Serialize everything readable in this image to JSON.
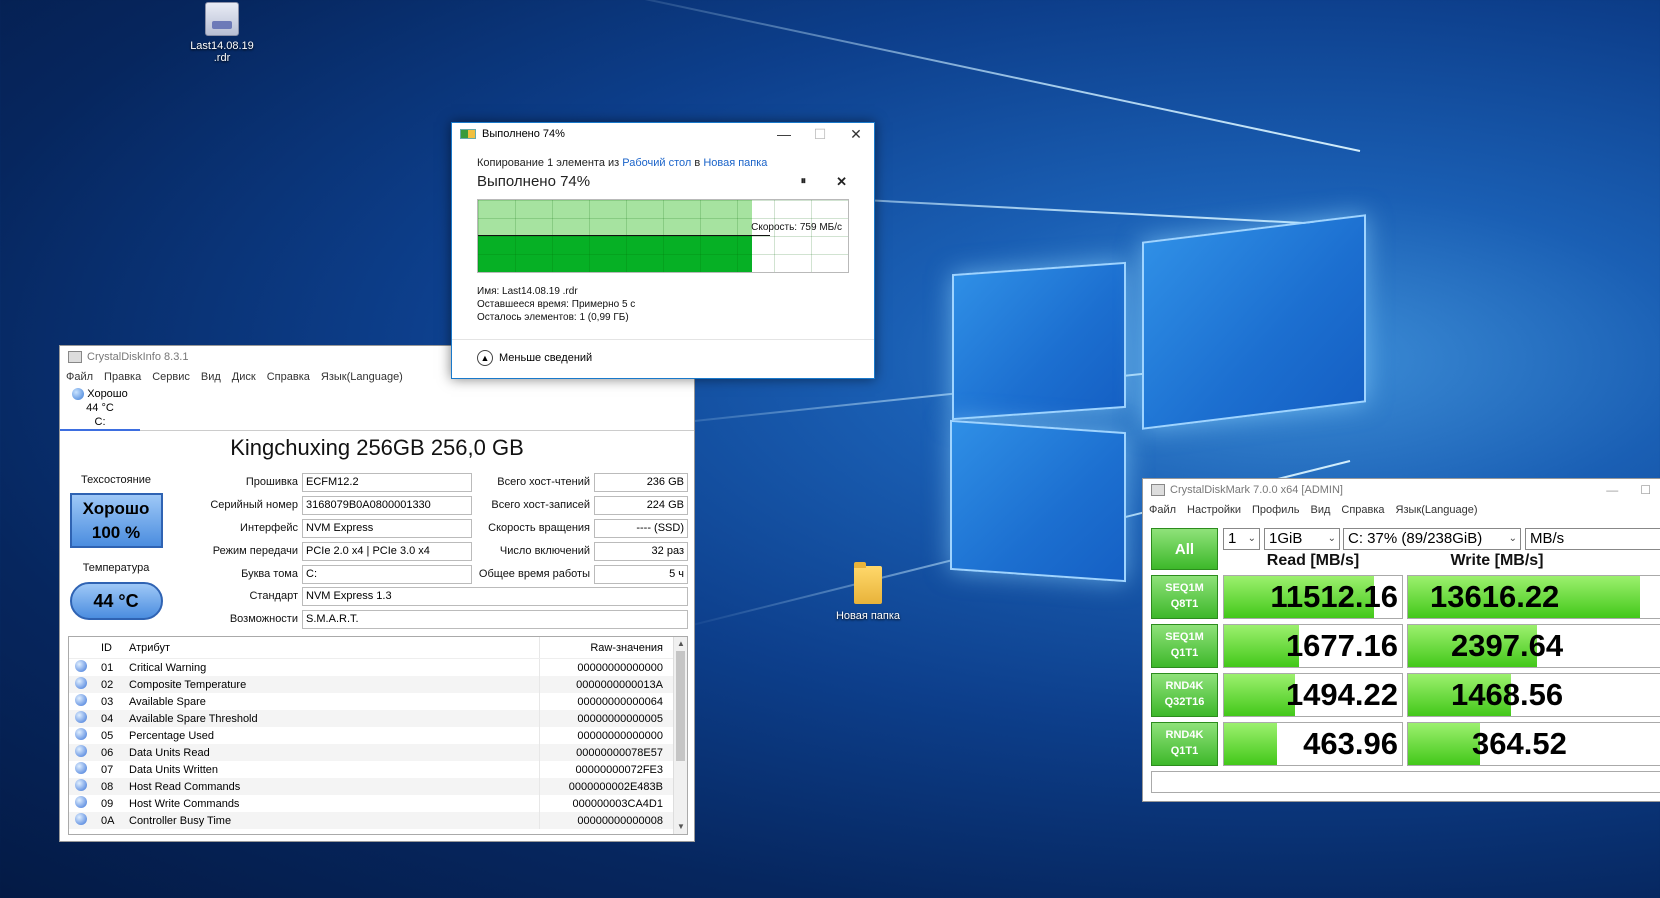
{
  "desktop": {
    "icons": [
      {
        "label1": "Last14.08.19",
        "label2": ".rdr"
      },
      {
        "label1": "Новая папка",
        "label2": ""
      }
    ]
  },
  "copy_dialog": {
    "title": "Выполнено 74%",
    "line_prefix": "Копирование 1 элемента из",
    "from": "Рабочий стол",
    "in_word": "в",
    "to": "Новая папка",
    "heading": "Выполнено 74%",
    "pause_glyph": "⏸",
    "close_glyph": "✕",
    "progress": 0.74,
    "speed": "Скорость: 759 МБ/с",
    "name_label": "Имя:",
    "name_value": "Last14.08.19 .rdr",
    "time_label": "Оставшееся время:",
    "time_value": "Примерно 5 с",
    "items_label": "Осталось элементов:",
    "items_value": "1 (0,99 ГБ)",
    "less_details": "Меньше сведений"
  },
  "cdi": {
    "title": "CrystalDiskInfo 8.3.1",
    "menu": [
      "Файл",
      "Правка",
      "Сервис",
      "Вид",
      "Диск",
      "Справка",
      "Язык(Language)"
    ],
    "tab_status": "Хорошо",
    "tab_temp": "44 °C",
    "tab_drive": "C:",
    "model": "Kingchuxing 256GB 256,0 GB",
    "health_label": "Техсостояние",
    "health_status": "Хорошо",
    "health_percent": "100 %",
    "temp_label": "Температура",
    "temp_value": "44 °C",
    "fields_left": [
      {
        "k": "Прошивка",
        "v": "ECFM12.2"
      },
      {
        "k": "Серийный номер",
        "v": "3168079B0A0800001330"
      },
      {
        "k": "Интерфейс",
        "v": "NVM Express"
      },
      {
        "k": "Режим передачи",
        "v": "PCIe 2.0 x4 | PCIe 3.0 x4"
      },
      {
        "k": "Буква тома",
        "v": "C:"
      },
      {
        "k": "Стандарт",
        "v": "NVM Express 1.3"
      },
      {
        "k": "Возможности",
        "v": "S.M.A.R.T."
      }
    ],
    "fields_right": [
      {
        "k": "Всего хост-чтений",
        "v": "236 GB"
      },
      {
        "k": "Всего хост-записей",
        "v": "224 GB"
      },
      {
        "k": "Скорость вращения",
        "v": "---- (SSD)"
      },
      {
        "k": "Число включений",
        "v": "32 раз"
      },
      {
        "k": "Общее время работы",
        "v": "5 ч"
      }
    ],
    "table_headers": {
      "id": "ID",
      "attr": "Атрибут",
      "raw": "Raw-значения"
    },
    "rows": [
      {
        "id": "01",
        "name": "Critical Warning",
        "raw": "00000000000000"
      },
      {
        "id": "02",
        "name": "Composite Temperature",
        "raw": "0000000000013A"
      },
      {
        "id": "03",
        "name": "Available Spare",
        "raw": "00000000000064"
      },
      {
        "id": "04",
        "name": "Available Spare Threshold",
        "raw": "00000000000005"
      },
      {
        "id": "05",
        "name": "Percentage Used",
        "raw": "00000000000000"
      },
      {
        "id": "06",
        "name": "Data Units Read",
        "raw": "00000000078E57"
      },
      {
        "id": "07",
        "name": "Data Units Written",
        "raw": "00000000072FE3"
      },
      {
        "id": "08",
        "name": "Host Read Commands",
        "raw": "0000000002E483B"
      },
      {
        "id": "09",
        "name": "Host Write Commands",
        "raw": "000000003CA4D1"
      },
      {
        "id": "0A",
        "name": "Controller Busy Time",
        "raw": "00000000000008"
      }
    ]
  },
  "cdm": {
    "title": "CrystalDiskMark 7.0.0 x64 [ADMIN]",
    "menu": [
      "Файл",
      "Настройки",
      "Профиль",
      "Вид",
      "Справка",
      "Язык(Language)"
    ],
    "all_label": "All",
    "count": "1",
    "size": "1GiB",
    "drive": "C: 37% (89/238GiB)",
    "unit": "MB/s",
    "read_header": "Read [MB/s]",
    "write_header": "Write [MB/s]",
    "tests": [
      {
        "line1": "SEQ1M",
        "line2": "Q8T1",
        "read": "11512.16",
        "write": "13616.22",
        "read_fill": 0.84,
        "write_fill": 0.9
      },
      {
        "line1": "SEQ1M",
        "line2": "Q1T1",
        "read": "1677.16",
        "write": "2397.64",
        "read_fill": 0.42,
        "write_fill": 0.5
      },
      {
        "line1": "RND4K",
        "line2": "Q32T16",
        "read": "1494.22",
        "write": "1468.56",
        "read_fill": 0.4,
        "write_fill": 0.4
      },
      {
        "line1": "RND4K",
        "line2": "Q1T1",
        "read": "463.96",
        "write": "364.52",
        "read_fill": 0.3,
        "write_fill": 0.28
      }
    ]
  }
}
